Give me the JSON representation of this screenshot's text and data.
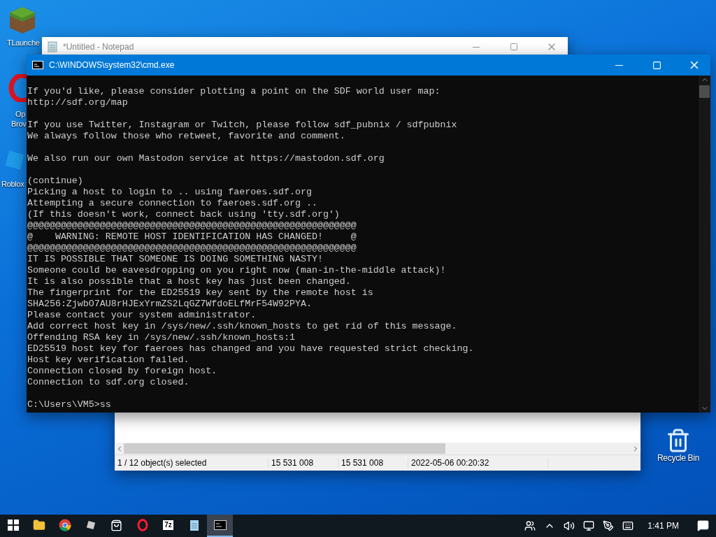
{
  "desktop_icons": [
    {
      "kind": "grass-block",
      "label_lines": [
        "TLaunche"
      ]
    },
    {
      "kind": "opera",
      "label_lines": [
        "Op",
        "Brov"
      ]
    },
    {
      "kind": "roblox",
      "label_lines": [
        "Roblox"
      ]
    }
  ],
  "notepad": {
    "title": "*Untitled - Notepad"
  },
  "explorer": {
    "status_bar": [
      "1 / 12 object(s) selected",
      "15 531 008",
      "15 531 008",
      "2022-05-06 00:20:32"
    ]
  },
  "cmd": {
    "title": "C:\\WINDOWS\\system32\\cmd.exe",
    "blocks": [
      [
        "If you'd like, please consider plotting a point on the SDF world user map:",
        "http://sdf.org/map"
      ],
      [
        "If you use Twitter, Instagram or Twitch, please follow sdf_pubnix / sdfpubnix",
        "We always follow those who retweet, favorite and comment."
      ],
      [
        "We also run our own Mastodon service at https://mastodon.sdf.org"
      ],
      [
        "(continue)",
        "Picking a host to login to .. using faeroes.sdf.org",
        "Attempting a secure connection to faeroes.sdf.org ..",
        "(If this doesn't work, connect back using 'tty.sdf.org')",
        "@@@@@@@@@@@@@@@@@@@@@@@@@@@@@@@@@@@@@@@@@@@@@@@@@@@@@@@@@@@",
        "@    WARNING: REMOTE HOST IDENTIFICATION HAS CHANGED!     @",
        "@@@@@@@@@@@@@@@@@@@@@@@@@@@@@@@@@@@@@@@@@@@@@@@@@@@@@@@@@@@",
        "IT IS POSSIBLE THAT SOMEONE IS DOING SOMETHING NASTY!",
        "Someone could be eavesdropping on you right now (man-in-the-middle attack)!",
        "It is also possible that a host key has just been changed.",
        "The fingerprint for the ED25519 key sent by the remote host is",
        "SHA256:ZjwbO7AU8rHJExYrmZS2LqGZ7WfdoELfMrF54W92PYA.",
        "Please contact your system administrator.",
        "Add correct host key in /sys/new/.ssh/known_hosts to get rid of this message.",
        "Offending RSA key in /sys/new/.ssh/known_hosts:1",
        "ED25519 host key for faeroes has changed and you have requested strict checking.",
        "Host key verification failed.",
        "Connection closed by foreign host.",
        "Connection to sdf.org closed."
      ]
    ],
    "prompt": "C:\\Users\\VM5>ss"
  },
  "recycle_bin": {
    "label": "Recycle Bin"
  },
  "taskbar": {
    "apps": [
      {
        "kind": "start",
        "selected": false
      },
      {
        "kind": "folder",
        "selected": false
      },
      {
        "kind": "chrome",
        "selected": false
      },
      {
        "kind": "roblox",
        "selected": false
      },
      {
        "kind": "store",
        "selected": false
      },
      {
        "kind": "opera",
        "selected": false
      },
      {
        "kind": "sevenzip",
        "selected": false,
        "label": "7z"
      },
      {
        "kind": "notepad",
        "selected": false
      },
      {
        "kind": "cmd",
        "selected": true
      }
    ],
    "tray": [
      {
        "kind": "people"
      },
      {
        "kind": "chevron"
      },
      {
        "kind": "volume"
      },
      {
        "kind": "network"
      },
      {
        "kind": "pen"
      },
      {
        "kind": "keyboard"
      }
    ],
    "clock": "1:41 PM"
  }
}
